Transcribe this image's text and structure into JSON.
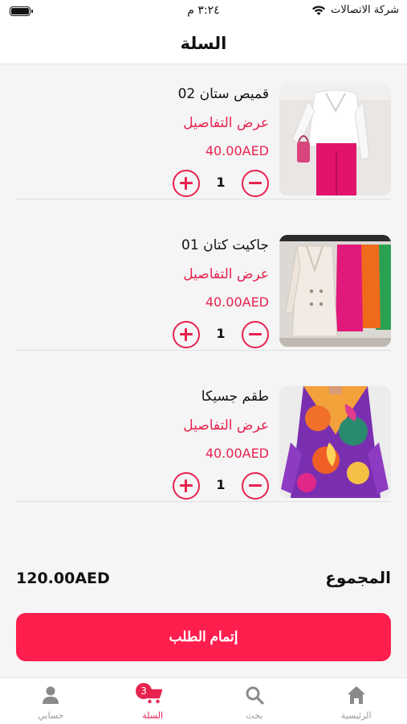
{
  "status_bar": {
    "carrier": "شركة الاتصالات",
    "time": "٣:٢٤ م"
  },
  "header": {
    "title": "السلة"
  },
  "cart": {
    "items": [
      {
        "name": "قميص ستان 02",
        "details_label": "عرض التفاصيل",
        "price": "40.00AED",
        "quantity": "1",
        "image": "pink-outfit-photo"
      },
      {
        "name": "جاكيت كتان 01",
        "details_label": "عرض التفاصيل",
        "price": "40.00AED",
        "quantity": "1",
        "image": "colored-jackets-photo"
      },
      {
        "name": "طقم جسيكا",
        "details_label": "عرض التفاصيل",
        "price": "40.00AED",
        "quantity": "1",
        "image": "printed-dress-photo"
      }
    ]
  },
  "summary": {
    "total_label": "المجموع",
    "total_value": "120.00AED"
  },
  "checkout": {
    "label": "إتمام الطلب"
  },
  "tab_bar": {
    "tabs": [
      {
        "label": "حسابي",
        "icon": "user-icon"
      },
      {
        "label": "السلة",
        "icon": "cart-icon",
        "badge": "3",
        "active": true
      },
      {
        "label": "بحث",
        "icon": "search-icon"
      },
      {
        "label": "الرئيسية",
        "icon": "home-icon"
      }
    ]
  },
  "colors": {
    "accent": "#e8224f",
    "checkout_button": "#ff1e4e"
  }
}
